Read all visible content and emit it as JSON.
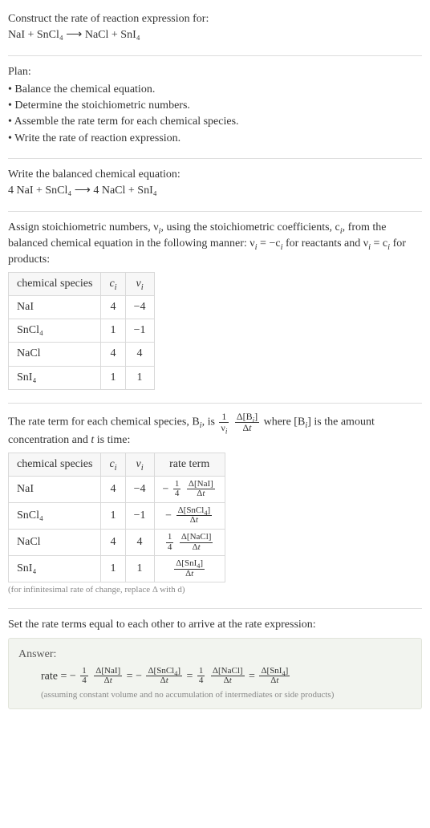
{
  "prompt": {
    "head_line": "Construct the rate of reaction expression for:",
    "equation_text": "NaI + SnCl₄  ⟶  NaCl + SnI₄"
  },
  "plan": {
    "label": "Plan:",
    "items": [
      "Balance the chemical equation.",
      "Determine the stoichiometric numbers.",
      "Assemble the rate term for each chemical species.",
      "Write the rate of reaction expression."
    ]
  },
  "balanced": {
    "intro": "Write the balanced chemical equation:",
    "equation_text": "4 NaI + SnCl₄  ⟶  4 NaCl + SnI₄"
  },
  "stoich": {
    "intro_html": "Assign stoichiometric numbers, ν<sub><i>i</i></sub>, using the stoichiometric coefficients, c<sub><i>i</i></sub>, from the balanced chemical equation in the following manner: ν<sub><i>i</i></sub> = −c<sub><i>i</i></sub> for reactants and ν<sub><i>i</i></sub> = c<sub><i>i</i></sub> for products:",
    "headers": {
      "species": "chemical species",
      "c": "cᵢ",
      "v": "νᵢ"
    },
    "rows": [
      {
        "species": "NaI",
        "c": "4",
        "v": "−4"
      },
      {
        "species": "SnCl₄",
        "c": "1",
        "v": "−1"
      },
      {
        "species": "NaCl",
        "c": "4",
        "v": "4"
      },
      {
        "species": "SnI₄",
        "c": "1",
        "v": "1"
      }
    ]
  },
  "rate_terms": {
    "intro_pre": "The rate term for each chemical species, B",
    "intro_mid1": ", is ",
    "intro_mid2": " where [B",
    "intro_mid3": "] is the amount concentration and ",
    "intro_post": " is time:",
    "frac1": {
      "num": "1",
      "den_html": "ν<sub><i>i</i></sub>"
    },
    "frac2": {
      "num_html": "Δ[B<sub><i>i</i></sub>]",
      "den_html": "Δ<i>t</i>"
    },
    "t_var": "t",
    "headers": {
      "species": "chemical species",
      "c": "cᵢ",
      "v": "νᵢ",
      "rate": "rate term"
    },
    "rows": [
      {
        "species": "NaI",
        "c": "4",
        "v": "−4",
        "rate_html": "− <span class='frac small'><span class='num'>1</span><span class='den'>4</span></span> <span class='frac small'><span class='num'>Δ[NaI]</span><span class='den'>Δ<i>t</i></span></span>"
      },
      {
        "species": "SnCl₄",
        "c": "1",
        "v": "−1",
        "rate_html": "− <span class='frac small'><span class='num'>Δ[SnCl<sub>4</sub>]</span><span class='den'>Δ<i>t</i></span></span>"
      },
      {
        "species": "NaCl",
        "c": "4",
        "v": "4",
        "rate_html": "<span class='frac small'><span class='num'>1</span><span class='den'>4</span></span> <span class='frac small'><span class='num'>Δ[NaCl]</span><span class='den'>Δ<i>t</i></span></span>"
      },
      {
        "species": "SnI₄",
        "c": "1",
        "v": "1",
        "rate_html": "<span class='frac small'><span class='num'>Δ[SnI<sub>4</sub>]</span><span class='den'>Δ<i>t</i></span></span>"
      }
    ],
    "caption": "(for infinitesimal rate of change, replace Δ with d)"
  },
  "final": {
    "intro": "Set the rate terms equal to each other to arrive at the rate expression:",
    "answer_label": "Answer:",
    "expr_html": "rate = − <span class='frac small'><span class='num'>1</span><span class='den'>4</span></span> <span class='frac small'><span class='num'>Δ[NaI]</span><span class='den'>Δ<i>t</i></span></span> = − <span class='frac small'><span class='num'>Δ[SnCl<sub>4</sub>]</span><span class='den'>Δ<i>t</i></span></span> = <span class='frac small'><span class='num'>1</span><span class='den'>4</span></span> <span class='frac small'><span class='num'>Δ[NaCl]</span><span class='den'>Δ<i>t</i></span></span> = <span class='frac small'><span class='num'>Δ[SnI<sub>4</sub>]</span><span class='den'>Δ<i>t</i></span></span>",
    "note": "(assuming constant volume and no accumulation of intermediates or side products)"
  },
  "chart_data": {
    "type": "table",
    "tables": [
      {
        "title": "Stoichiometric numbers",
        "columns": [
          "chemical species",
          "c_i",
          "nu_i"
        ],
        "rows": [
          [
            "NaI",
            4,
            -4
          ],
          [
            "SnCl4",
            1,
            -1
          ],
          [
            "NaCl",
            4,
            4
          ],
          [
            "SnI4",
            1,
            1
          ]
        ]
      },
      {
        "title": "Rate terms",
        "columns": [
          "chemical species",
          "c_i",
          "nu_i",
          "rate term"
        ],
        "rows": [
          [
            "NaI",
            4,
            -4,
            "-(1/4) d[NaI]/dt"
          ],
          [
            "SnCl4",
            1,
            -1,
            "- d[SnCl4]/dt"
          ],
          [
            "NaCl",
            4,
            4,
            "(1/4) d[NaCl]/dt"
          ],
          [
            "SnI4",
            1,
            1,
            "d[SnI4]/dt"
          ]
        ]
      }
    ],
    "equations": {
      "unbalanced": "NaI + SnCl4 -> NaCl + SnI4",
      "balanced": "4 NaI + SnCl4 -> 4 NaCl + SnI4",
      "rate_expression": "rate = -(1/4) d[NaI]/dt = - d[SnCl4]/dt = (1/4) d[NaCl]/dt = d[SnI4]/dt"
    }
  }
}
